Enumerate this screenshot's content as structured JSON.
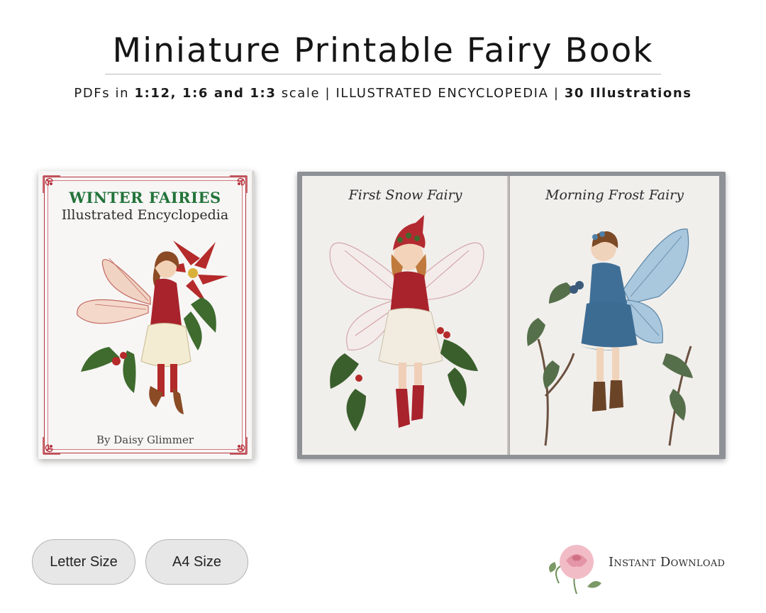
{
  "header": {
    "title": "Miniature Printable Fairy Book",
    "subtitle_prefix": "PDFs in ",
    "subtitle_scales": "1:12, 1:6 and 1:3",
    "subtitle_mid": " scale | ILLUSTRATED ENCYCLOPEDIA | ",
    "subtitle_count": "30 Illustrations"
  },
  "cover": {
    "title": "WINTER FAIRIES",
    "subtitle": "Illustrated Encyclopedia",
    "author": "By Daisy Glimmer"
  },
  "open_book": {
    "left_page_title": "First Snow Fairy",
    "right_page_title": "Morning Frost Fairy"
  },
  "buttons": {
    "letter": "Letter Size",
    "a4": "A4 Size"
  },
  "badge": {
    "label": "Instant Download"
  },
  "colors": {
    "cover_title": "#23733a",
    "frame_red": "#b6323d",
    "book_gray": "#8e9196",
    "pill_bg": "#e7e7e8"
  }
}
